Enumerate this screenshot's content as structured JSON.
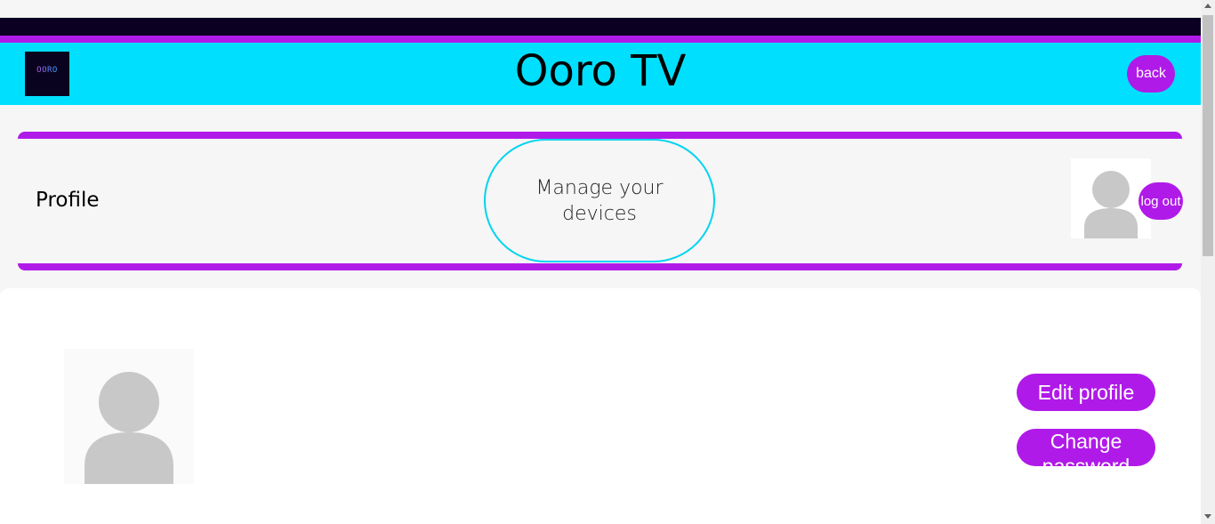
{
  "header": {
    "logo_text": "OORO",
    "title": "Ooro TV",
    "back_label": "back"
  },
  "profile_bar": {
    "title": "Profile",
    "manage_devices_label": "Manage your devices",
    "logout_label": "log out"
  },
  "profile_card": {
    "edit_profile_label": "Edit profile",
    "change_password_label": "Change password"
  },
  "colors": {
    "accent_purple": "#b01ae8",
    "header_cyan": "#00e0fe",
    "top_strip_dark": "#0b0022",
    "avatar_gray": "#c8c8c8"
  },
  "icons": {
    "avatar": "user-silhouette-icon",
    "logo": "ooro-logo"
  }
}
